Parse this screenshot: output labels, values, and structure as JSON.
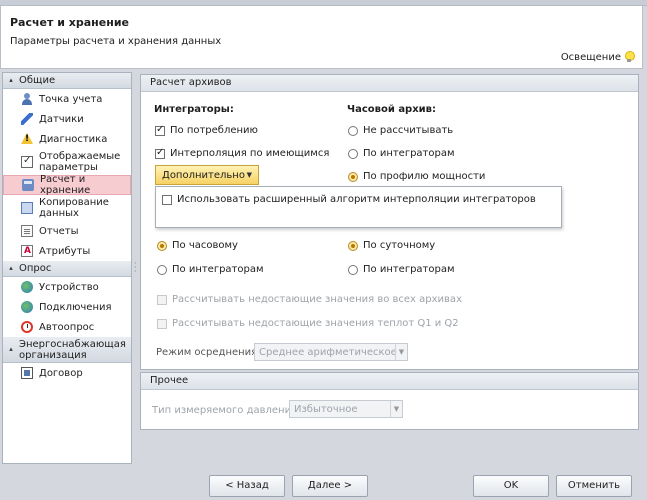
{
  "header": {
    "title": "Расчет и хранение",
    "subtitle": "Параметры расчета и хранения данных",
    "lighting_label": "Освещение"
  },
  "sidebar": {
    "groups": [
      {
        "label": "Общие",
        "items": [
          {
            "label": "Точка учета",
            "icon": "meter-point-icon"
          },
          {
            "label": "Датчики",
            "icon": "sensors-icon"
          },
          {
            "label": "Диагностика",
            "icon": "warning-icon"
          },
          {
            "label": "Отображаемые параметры",
            "icon": "checklist-icon"
          },
          {
            "label": "Расчет и хранение",
            "icon": "storage-icon",
            "selected": true
          },
          {
            "label": "Копирование данных",
            "icon": "copy-icon"
          },
          {
            "label": "Отчеты",
            "icon": "report-icon"
          },
          {
            "label": "Атрибуты",
            "icon": "attributes-icon"
          }
        ]
      },
      {
        "label": "Опрос",
        "items": [
          {
            "label": "Устройство",
            "icon": "device-icon"
          },
          {
            "label": "Подключения",
            "icon": "connections-icon"
          },
          {
            "label": "Автоопрос",
            "icon": "alarm-clock-icon"
          }
        ]
      },
      {
        "label": "Энергоснабжающая организация",
        "items": [
          {
            "label": "Договор",
            "icon": "contract-icon"
          }
        ]
      }
    ]
  },
  "archive": {
    "section_title": "Расчет архивов",
    "integrators_heading": "Интеграторы:",
    "hourly_heading": "Часовой архив:",
    "integrator_options": [
      {
        "label": "По потреблению",
        "checked": true
      },
      {
        "label": "Интерполяция по имеющимся",
        "checked": true
      }
    ],
    "hourly_options": [
      {
        "label": "Не рассчитывать",
        "selected": false
      },
      {
        "label": "По интеграторам",
        "selected": false
      },
      {
        "label": "По профилю мощности",
        "selected": true
      }
    ],
    "more_button": "Дополнительно",
    "popup_option": {
      "label": "Использовать расширенный алгоритм интерполяции интеграторов",
      "checked": false
    },
    "left_radios": [
      {
        "label": "По часовому",
        "selected": true
      },
      {
        "label": "По интеграторам",
        "selected": false
      }
    ],
    "right_radios": [
      {
        "label": "По суточному",
        "selected": true
      },
      {
        "label": "По интеграторам",
        "selected": false
      }
    ],
    "calc_missing_all": "Рассчитывать недостающие значения во всех архивах",
    "calc_missing_q": "Рассчитывать недостающие значения теплот Q1 и Q2",
    "averaging_label": "Режим осреднения:",
    "averaging_value": "Среднее арифметическое"
  },
  "other": {
    "section_title": "Прочее",
    "pressure_label": "Тип измеряемого давления:",
    "pressure_value": "Избыточное"
  },
  "footer": {
    "back": "< Назад",
    "next": "Далее >",
    "ok": "OK",
    "cancel": "Отменить"
  }
}
